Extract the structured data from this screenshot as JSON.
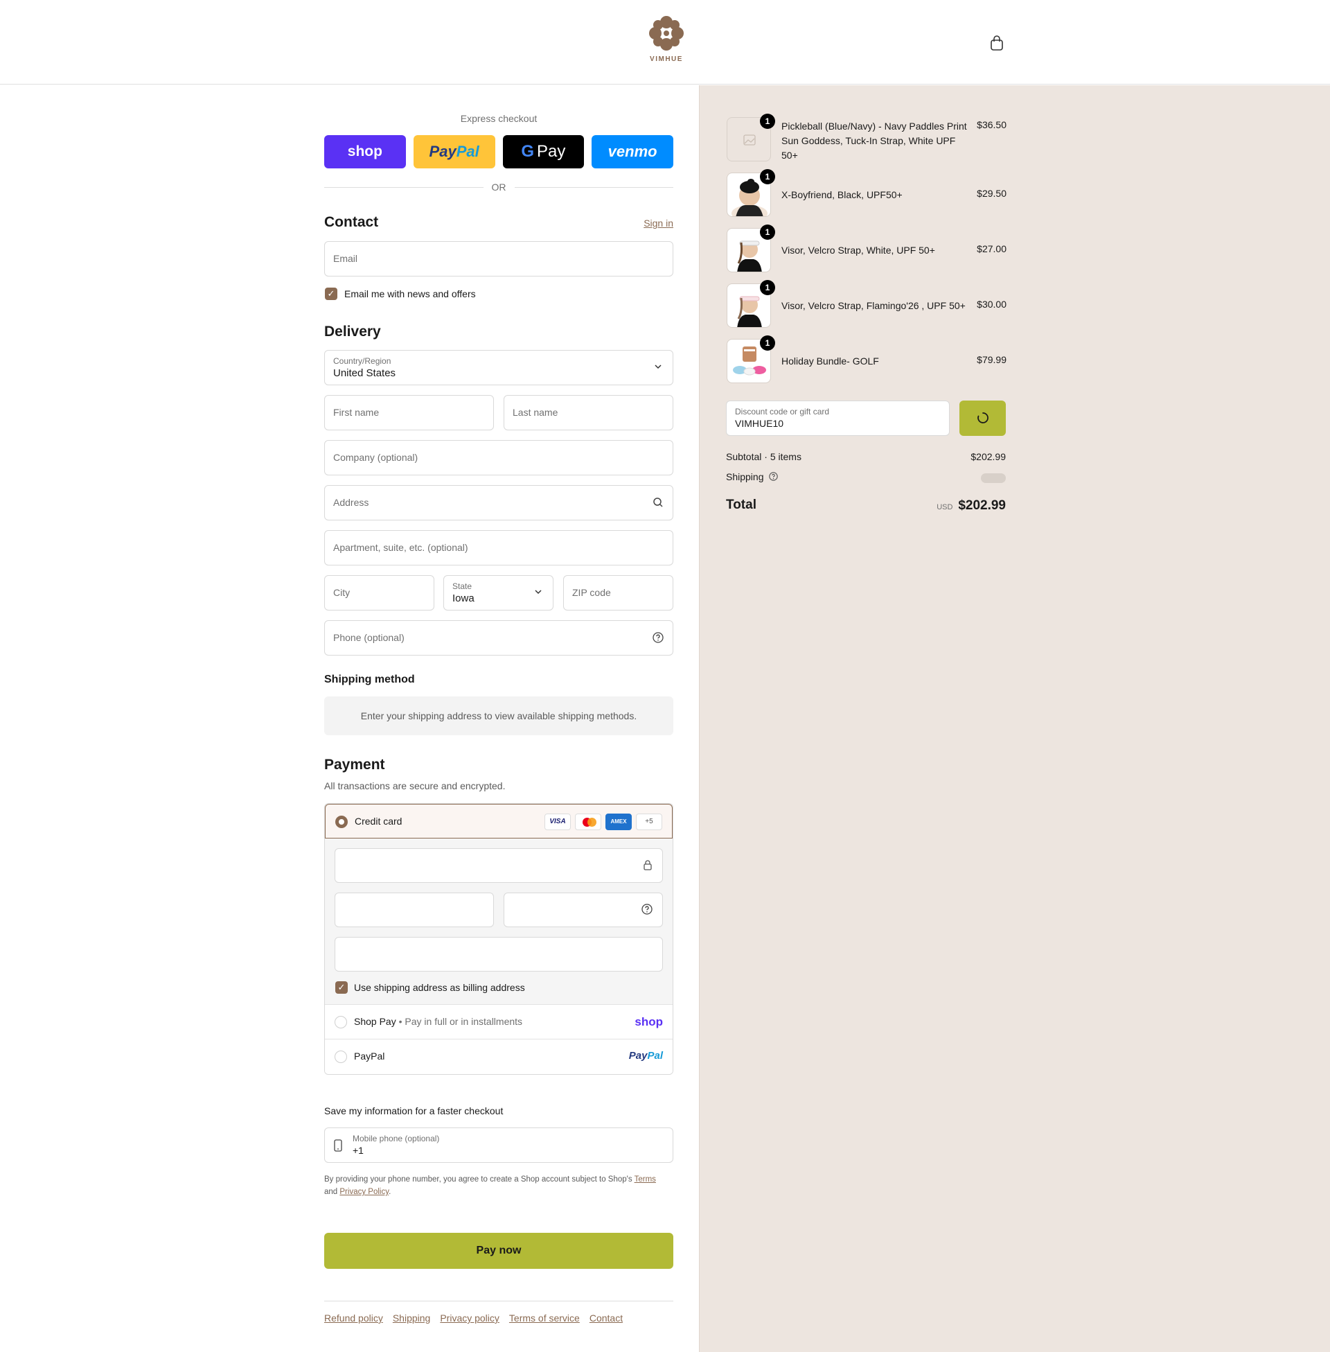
{
  "header": {
    "brand": "VIMHUE",
    "cart_icon": "shopping-bag-icon"
  },
  "express": {
    "label": "Express checkout",
    "buttons": {
      "shop": "shop",
      "paypal_pay": "Pay",
      "paypal_pal": "Pal",
      "gpay_g": "G",
      "gpay_text": "Pay",
      "venmo": "venmo"
    },
    "or": "OR"
  },
  "contact": {
    "title": "Contact",
    "sign_in": "Sign in",
    "email_placeholder": "Email",
    "news_label": "Email me with news and offers"
  },
  "delivery": {
    "title": "Delivery",
    "country_label": "Country/Region",
    "country_value": "United States",
    "first_name": "First name",
    "last_name": "Last name",
    "company": "Company (optional)",
    "address": "Address",
    "apartment": "Apartment, suite, etc. (optional)",
    "city": "City",
    "state_label": "State",
    "state_value": "Iowa",
    "zip": "ZIP code",
    "phone": "Phone (optional)"
  },
  "shipping_method": {
    "title": "Shipping method",
    "message": "Enter your shipping address to view available shipping methods."
  },
  "payment": {
    "title": "Payment",
    "subtitle": "All transactions are secure and encrypted.",
    "credit_card": "Credit card",
    "cards": {
      "visa": "VISA",
      "amex": "AMEX",
      "more": "+5"
    },
    "billing_label": "Use shipping address as billing address",
    "shop_pay": "Shop Pay",
    "shop_pay_sub": "Pay in full or in installments",
    "shop_logo": "shop",
    "paypal": "PayPal",
    "paypal_logo_pay": "Pay",
    "paypal_logo_pal": "Pal"
  },
  "save_info": {
    "title": "Save my information for a faster checkout",
    "mobile_label": "Mobile phone (optional)",
    "mobile_value": "+1",
    "legal_1": "By providing your phone number, you agree to create a Shop account subject to Shop's ",
    "legal_terms": "Terms",
    "legal_and": "and ",
    "legal_privacy": "Privacy Policy",
    "legal_end": "."
  },
  "pay_now": "Pay now",
  "footer": {
    "links": [
      "Refund policy",
      "Shipping",
      "Privacy policy",
      "Terms of service",
      "Contact"
    ]
  },
  "order": {
    "items": [
      {
        "name": "Pickleball (Blue/Navy) - Navy Paddles Print Sun Goddess, Tuck-In Strap, White UPF 50+",
        "price": "$36.50",
        "qty": "1"
      },
      {
        "name": "X-Boyfriend, Black, UPF50+",
        "price": "$29.50",
        "qty": "1"
      },
      {
        "name": "Visor, Velcro Strap, White, UPF 50+",
        "price": "$27.00",
        "qty": "1"
      },
      {
        "name": "Visor, Velcro Strap, Flamingo'26 , UPF 50+",
        "price": "$30.00",
        "qty": "1"
      },
      {
        "name": "Holiday Bundle- GOLF",
        "price": "$79.99",
        "qty": "1"
      }
    ],
    "discount_label": "Discount code or gift card",
    "discount_value": "VIMHUE10",
    "subtotal_label": "Subtotal · 5 items",
    "subtotal_value": "$202.99",
    "shipping_label": "Shipping",
    "total_label": "Total",
    "currency": "USD",
    "total_value": "$202.99"
  },
  "colors": {
    "accent": "#8a6a52",
    "pay_button": "#b2ba36",
    "sidebar_bg": "#ede5df"
  }
}
